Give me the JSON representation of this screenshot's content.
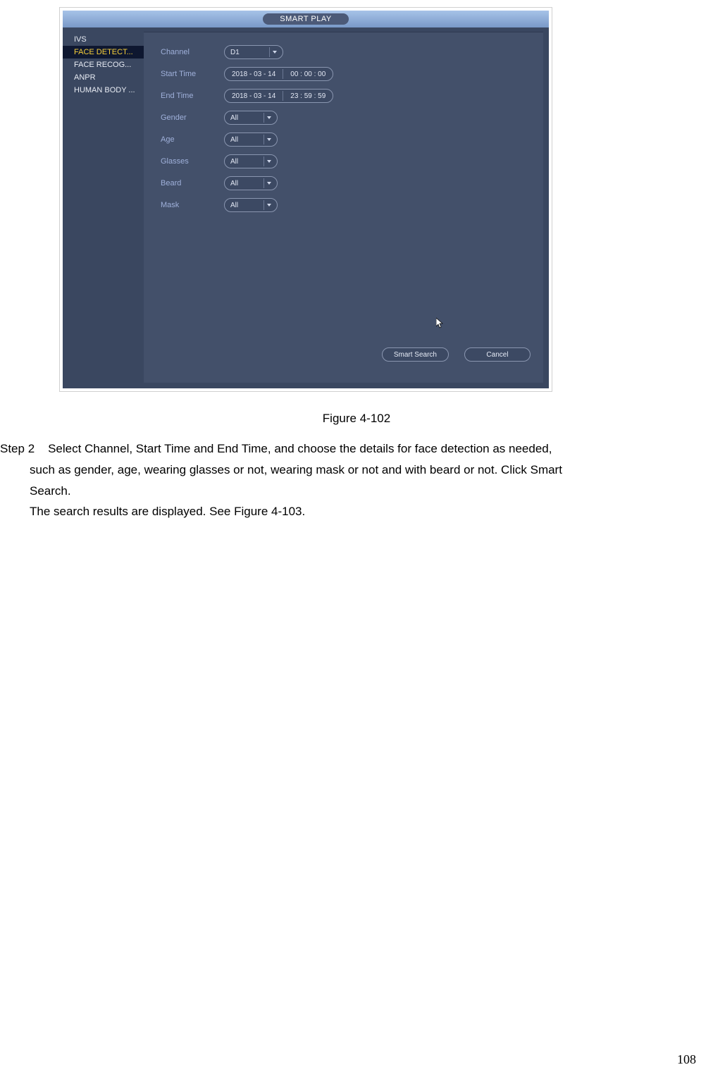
{
  "app": {
    "title": "SMART PLAY"
  },
  "sidebar": {
    "items": [
      {
        "label": "IVS"
      },
      {
        "label": "FACE DETECT..."
      },
      {
        "label": "FACE RECOG..."
      },
      {
        "label": "ANPR"
      },
      {
        "label": "HUMAN BODY ..."
      }
    ],
    "selected_index": 1
  },
  "form": {
    "channel": {
      "label": "Channel",
      "value": "D1"
    },
    "start_time": {
      "label": "Start Time",
      "date": "2018  - 03  - 14",
      "time": "00 : 00  : 00"
    },
    "end_time": {
      "label": "End Time",
      "date": "2018  - 03  - 14",
      "time": "23 : 59  : 59"
    },
    "gender": {
      "label": "Gender",
      "value": "All"
    },
    "age": {
      "label": "Age",
      "value": "All"
    },
    "glasses": {
      "label": "Glasses",
      "value": "All"
    },
    "beard": {
      "label": "Beard",
      "value": "All"
    },
    "mask": {
      "label": "Mask",
      "value": "All"
    }
  },
  "buttons": {
    "search": "Smart Search",
    "cancel": "Cancel"
  },
  "caption": "Figure 4-102",
  "doc": {
    "step_prefix": "Step 2",
    "step_body_line1": "Select Channel, Start Time and End Time, and choose the details for face detection as needed,",
    "step_body_line2": "such as gender, age, wearing glasses or not, wearing mask or not and with beard or not. Click Smart",
    "step_body_line3": "Search.",
    "result_line": "The search results are displayed. See Figure 4-103."
  },
  "page_number": "108"
}
